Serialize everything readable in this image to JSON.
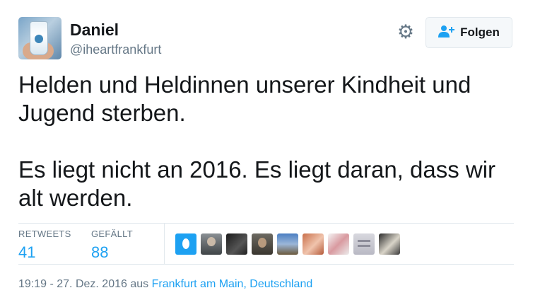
{
  "user": {
    "name": "Daniel",
    "handle": "@iheartfrankfurt"
  },
  "follow_button": {
    "label": "Folgen",
    "icon": "add-user-icon"
  },
  "settings_icon": "gear-icon",
  "tweet": {
    "paragraphs": [
      "Helden und Heldinnen unserer Kindheit und Jugend sterben.",
      "Es liegt nicht an 2016. Es liegt daran, dass wir alt werden."
    ]
  },
  "stats": {
    "retweets_label": "RETWEETS",
    "retweets_value": "41",
    "likes_label": "GEFÄLLT",
    "likes_value": "88"
  },
  "meta": {
    "timestamp": "19:19 - 27. Dez. 2016",
    "from_word": "aus",
    "place": "Frankfurt am Main, Deutschland"
  },
  "colors": {
    "accent": "#1da1f2",
    "muted": "#657786",
    "text": "#14171a",
    "border": "#e1e8ed"
  }
}
